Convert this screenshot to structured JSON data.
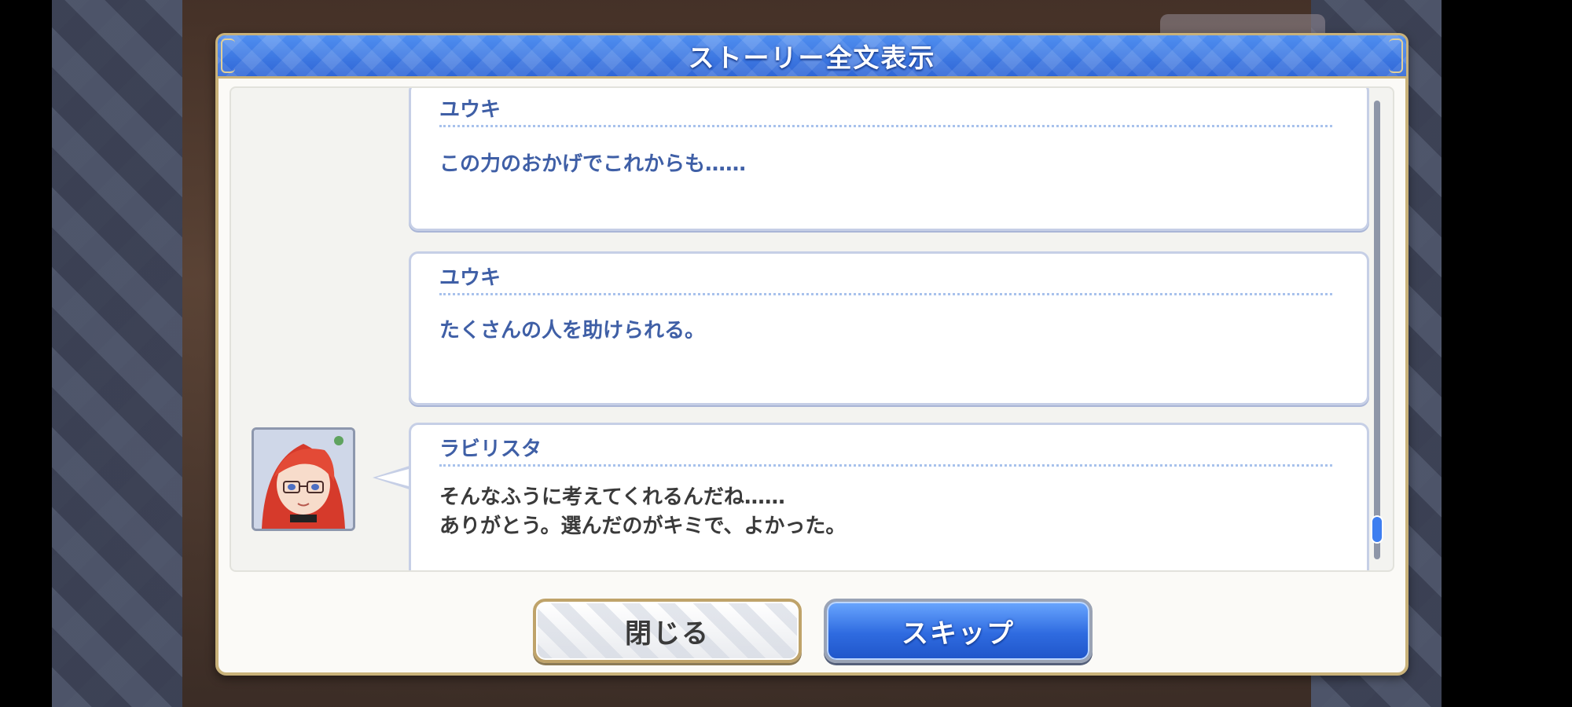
{
  "dialog": {
    "title": "ストーリー全文表示"
  },
  "log": {
    "entries": [
      {
        "speaker": "ユウキ",
        "text": "この力のおかげでこれからも……",
        "portrait": false
      },
      {
        "speaker": "ユウキ",
        "text": "たくさんの人を助けられる。",
        "portrait": false
      },
      {
        "speaker": "ラビリスタ",
        "text": "そんなふうに考えてくれるんだね……\nありがとう。選んだのがキミで、よかった。",
        "portrait": true,
        "portrait_icon": "red-haired-character-portrait"
      }
    ]
  },
  "buttons": {
    "close_label": "閉じる",
    "skip_label": "スキップ"
  },
  "colors": {
    "header_blue": "#2f66d6",
    "frame_gold": "#c9b27a",
    "speaker_blue": "#3f5fa6",
    "dialog_text": "#3a3a3a",
    "skip_blue": "#2f6be0",
    "scroll_thumb": "#3d7ef0"
  }
}
